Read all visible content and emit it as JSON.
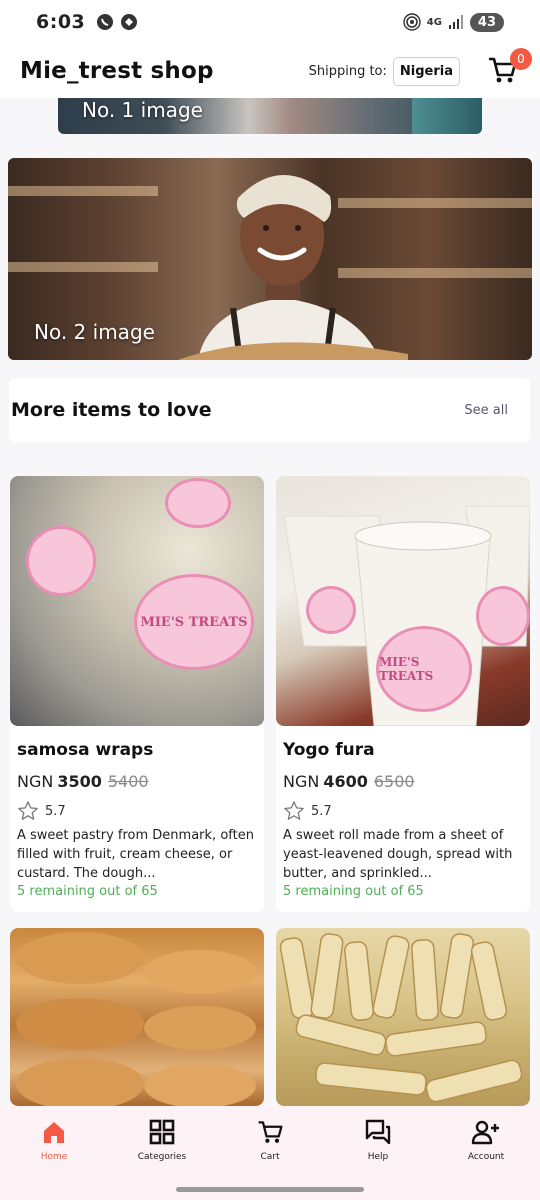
{
  "status": {
    "time": "6:03",
    "network": "4G",
    "battery": "43"
  },
  "header": {
    "title": "Mie_trest shop",
    "shipping_label": "Shipping to:",
    "country": "Nigeria",
    "cart_count": "0"
  },
  "banners": [
    {
      "label": "No. 1 image"
    },
    {
      "label": "No. 2 image"
    }
  ],
  "section": {
    "title": "More items to love",
    "see_all": "See all"
  },
  "products": [
    {
      "name": "samosa wraps",
      "currency": "NGN",
      "price": "3500",
      "old_price": "5400",
      "rating": "5.7",
      "description": "A sweet pastry from Denmark, often filled with fruit, cream cheese, or custard. The dough...",
      "stock": "5 remaining out of 65",
      "sticker": "MIE'S TREATS"
    },
    {
      "name": "Yogo fura",
      "currency": "NGN",
      "price": "4600",
      "old_price": "6500",
      "rating": "5.7",
      "description": "A sweet roll made from a sheet of yeast-leavened dough, spread with butter, and sprinkled...",
      "stock": "5 remaining out of 65",
      "sticker": "MIE'S TREATS"
    }
  ],
  "nav": {
    "items": [
      {
        "label": "Home",
        "icon": "home-icon"
      },
      {
        "label": "Categories",
        "icon": "categories-icon"
      },
      {
        "label": "Cart",
        "icon": "cart-icon"
      },
      {
        "label": "Help",
        "icon": "help-icon"
      },
      {
        "label": "Account",
        "icon": "account-icon"
      }
    ]
  },
  "colors": {
    "accent": "#f45a43",
    "stock_green": "#4fae56",
    "nav_bg": "#fdf2f6"
  }
}
